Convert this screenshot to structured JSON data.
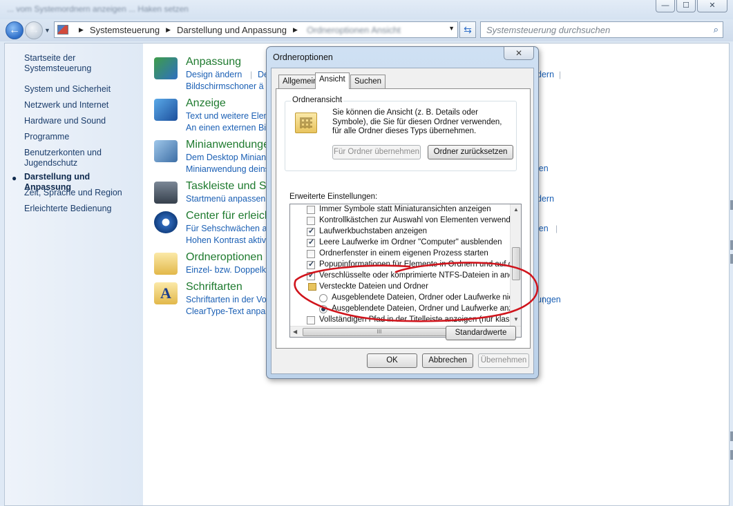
{
  "window": {
    "title_blurred": "... vom Systemordnern anzeigen ... Haken setzen",
    "controls": {
      "minimize": "—",
      "maximize": "☐",
      "close": "✕"
    }
  },
  "nav": {
    "address": [
      "Systemsteuerung",
      "Darstellung und Anpassung"
    ],
    "address_blurred": "Ordneroptionen   Ansicht",
    "search_placeholder": "Systemsteuerung durchsuchen"
  },
  "sidebar": {
    "items": [
      {
        "label": "Startseite der Systemsteuerung",
        "active": false
      },
      {
        "label": "System und Sicherheit",
        "active": false
      },
      {
        "label": "Netzwerk und Internet",
        "active": false
      },
      {
        "label": "Hardware und Sound",
        "active": false
      },
      {
        "label": "Programme",
        "active": false
      },
      {
        "label": "Benutzerkonten und Jugendschutz",
        "active": false
      },
      {
        "label": "Darstellung und Anpassung",
        "active": true
      },
      {
        "label": "Zeit, Sprache und Region",
        "active": false
      },
      {
        "label": "Erleichterte Bedienung",
        "active": false
      }
    ]
  },
  "categories": [
    {
      "title": "Anpassung",
      "links": [
        "Design ändern",
        "Bildschirmschoner ä"
      ],
      "extra": "De",
      "right": "dern",
      "icon": "display-personalize-icon"
    },
    {
      "title": "Anzeige",
      "links": [
        "Text und weitere Elem",
        "An einen externen Bild"
      ],
      "icon": "display-icon"
    },
    {
      "title": "Minianwendungen",
      "links": [
        "Dem Desktop Minianw",
        "Minianwendung deins"
      ],
      "right": "len",
      "icon": "gadgets-icon"
    },
    {
      "title": "Taskleiste und St",
      "links": [
        "Startmenü anpassen"
      ],
      "right": "dern",
      "icon": "taskbar-icon"
    },
    {
      "title": "Center für erleich",
      "links": [
        "Für Sehschwächen a",
        "Hohen Kontrast aktivi"
      ],
      "right": "len",
      "icon": "ease-of-access-icon"
    },
    {
      "title": "Ordneroptionen",
      "links": [
        "Einzel- bzw. Doppelkl"
      ],
      "icon": "folder-options-icon"
    },
    {
      "title": "Schriftarten",
      "links": [
        "Schriftarten in der Vor",
        "ClearType-Text anpas"
      ],
      "right": "ungen",
      "icon": "fonts-icon"
    }
  ],
  "dialog": {
    "title": "Ordneroptionen",
    "close": "✕",
    "tabs": [
      "Allgemein",
      "Ansicht",
      "Suchen"
    ],
    "selected_tab": "Ansicht",
    "folder_view": {
      "legend": "Ordneransicht",
      "text": "Sie können die Ansicht (z. B. Details oder Symbole), die Sie für diesen Ordner verwenden, für alle Ordner dieses Typs übernehmen.",
      "apply_button": "Für Ordner übernehmen",
      "reset_button": "Ordner zurücksetzen"
    },
    "advanced_label": "Erweiterte Einstellungen:",
    "settings": [
      {
        "type": "checkbox",
        "checked": false,
        "label": "Immer Symbole statt Miniaturansichten anzeigen"
      },
      {
        "type": "checkbox",
        "checked": false,
        "label": "Kontrollkästchen zur Auswahl von Elementen verwenden"
      },
      {
        "type": "checkbox",
        "checked": true,
        "label": "Laufwerkbuchstaben anzeigen"
      },
      {
        "type": "checkbox",
        "checked": true,
        "label": "Leere Laufwerke im Ordner \"Computer\" ausblenden"
      },
      {
        "type": "checkbox",
        "checked": false,
        "label": "Ordnerfenster in einem eigenen Prozess starten"
      },
      {
        "type": "checkbox",
        "checked": true,
        "label": "Popupinformationen für Elemente in Ordnern und auf dem D"
      },
      {
        "type": "checkbox",
        "checked": true,
        "label": "Verschlüsselte oder komprimierte NTFS-Dateien in anderer"
      },
      {
        "type": "folder",
        "checked": false,
        "label": "Versteckte Dateien und Ordner"
      },
      {
        "type": "radio",
        "checked": false,
        "label": "Ausgeblendete Dateien, Ordner oder Laufwerke nicht a"
      },
      {
        "type": "radio",
        "checked": true,
        "label": "Ausgeblendete Dateien, Ordner und Laufwerke anzeige"
      },
      {
        "type": "checkbox",
        "checked": false,
        "label": "Vollständigen Pfad in der Titelleiste anzeigen (nur klassisch"
      }
    ],
    "defaults_button": "Standardwerte",
    "ok_button": "OK",
    "cancel_button": "Abbrechen",
    "apply_button": "Übernehmen",
    "scroll_thumb_glyph": "III",
    "annotation_color": "#d0141c"
  }
}
